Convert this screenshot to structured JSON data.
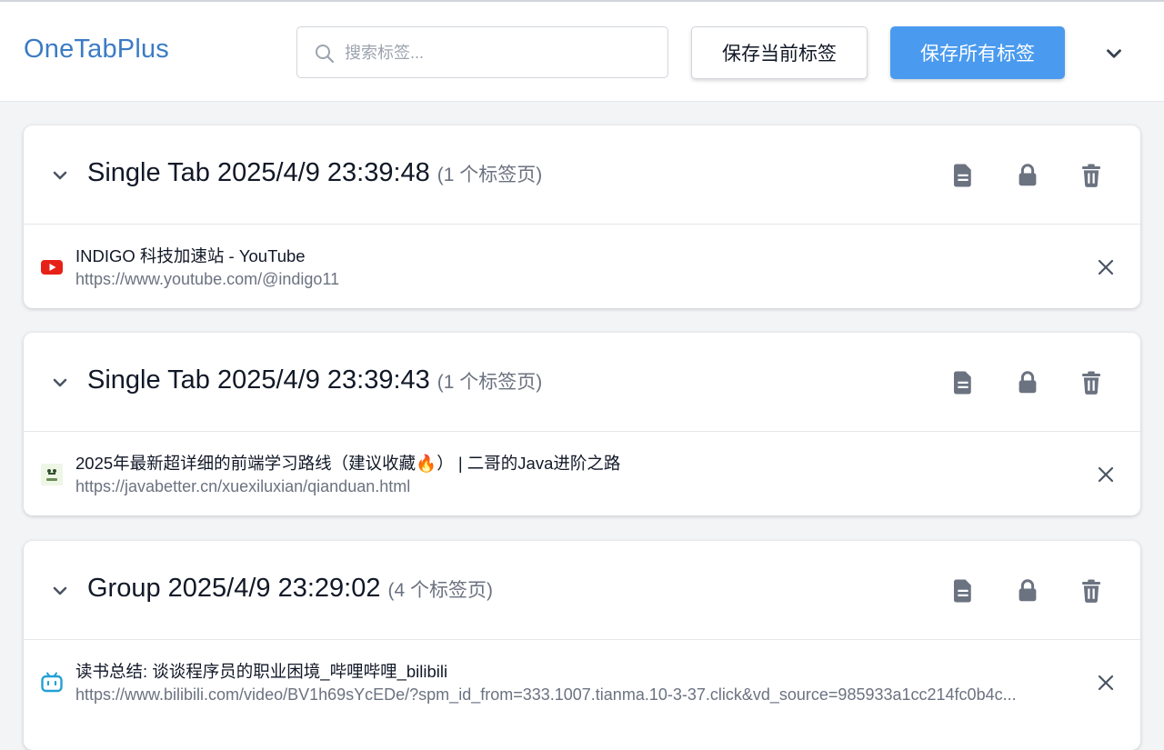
{
  "header": {
    "app_title": "OneTabPlus",
    "search_placeholder": "搜索标签...",
    "save_current_label": "保存当前标签",
    "save_all_label": "保存所有标签",
    "menu_icon": "chevron-down-icon"
  },
  "colors": {
    "brand": "#3b7cc4",
    "primary_button": "#4a9bef",
    "icon_gray": "#6b7280"
  },
  "groups": [
    {
      "title": "Single Tab 2025/4/9 23:39:48",
      "count": "(1 个标签页)",
      "actions": [
        "document-icon",
        "lock-icon",
        "trash-icon"
      ],
      "tabs": [
        {
          "favicon": "youtube-icon",
          "title": "INDIGO 科技加速站 - YouTube",
          "url": "https://www.youtube.com/@indigo11"
        }
      ]
    },
    {
      "title": "Single Tab 2025/4/9 23:39:43",
      "count": "(1 个标签页)",
      "actions": [
        "document-icon",
        "lock-icon",
        "trash-icon"
      ],
      "tabs": [
        {
          "favicon": "java-icon",
          "title": "2025年最新超详细的前端学习路线（建议收藏🔥） | 二哥的Java进阶之路",
          "url": "https://javabetter.cn/xuexiluxian/qianduan.html"
        }
      ]
    },
    {
      "title": "Group 2025/4/9 23:29:02",
      "count": "(4 个标签页)",
      "actions": [
        "document-icon",
        "lock-icon",
        "trash-icon"
      ],
      "tabs": [
        {
          "favicon": "bilibili-icon",
          "title": "读书总结: 谈谈程序员的职业困境_哔哩哔哩_bilibili",
          "url": "https://www.bilibili.com/video/BV1h69sYcEDe/?spm_id_from=333.1007.tianma.10-3-37.click&vd_source=985933a1cc214fc0b4c..."
        }
      ]
    }
  ]
}
